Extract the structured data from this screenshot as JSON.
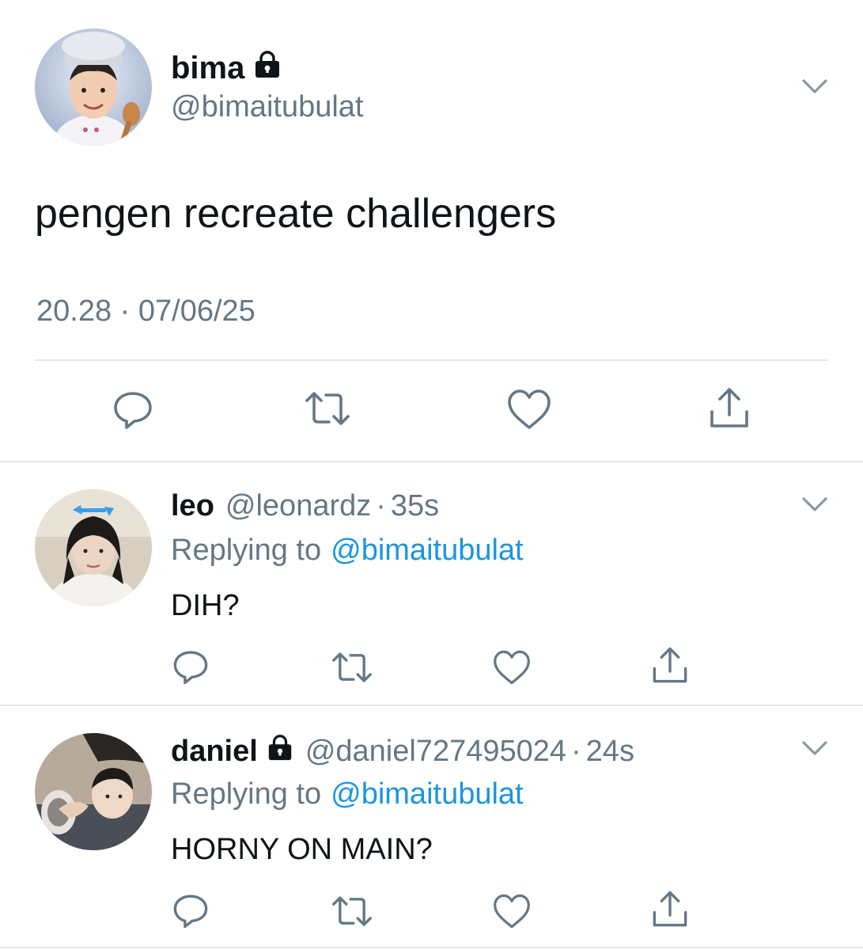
{
  "main_tweet": {
    "display_name": "bima",
    "handle": "@bimaitubulat",
    "text": "pengen recreate challengers",
    "timestamp": "20.28 · 07/06/25",
    "protected": true
  },
  "replies": [
    {
      "display_name": "leo",
      "handle": "@leonardz",
      "time": "35s",
      "replying_label": "Replying to",
      "replying_handle": "@bimaitubulat",
      "text": "DIH?",
      "protected": false
    },
    {
      "display_name": "daniel",
      "handle": "@daniel727495024",
      "time": "24s",
      "replying_label": "Replying to",
      "replying_handle": "@bimaitubulat",
      "text": "HORNY ON MAIN?",
      "protected": true
    }
  ],
  "separator": "·",
  "icons": [
    "lock-icon",
    "chevron-down-icon",
    "reply-icon",
    "retweet-icon",
    "like-icon",
    "share-icon"
  ],
  "colors": {
    "text": "#0f1419",
    "secondary": "#657786",
    "link": "#1b95e0",
    "divider": "#e1e8ed"
  }
}
